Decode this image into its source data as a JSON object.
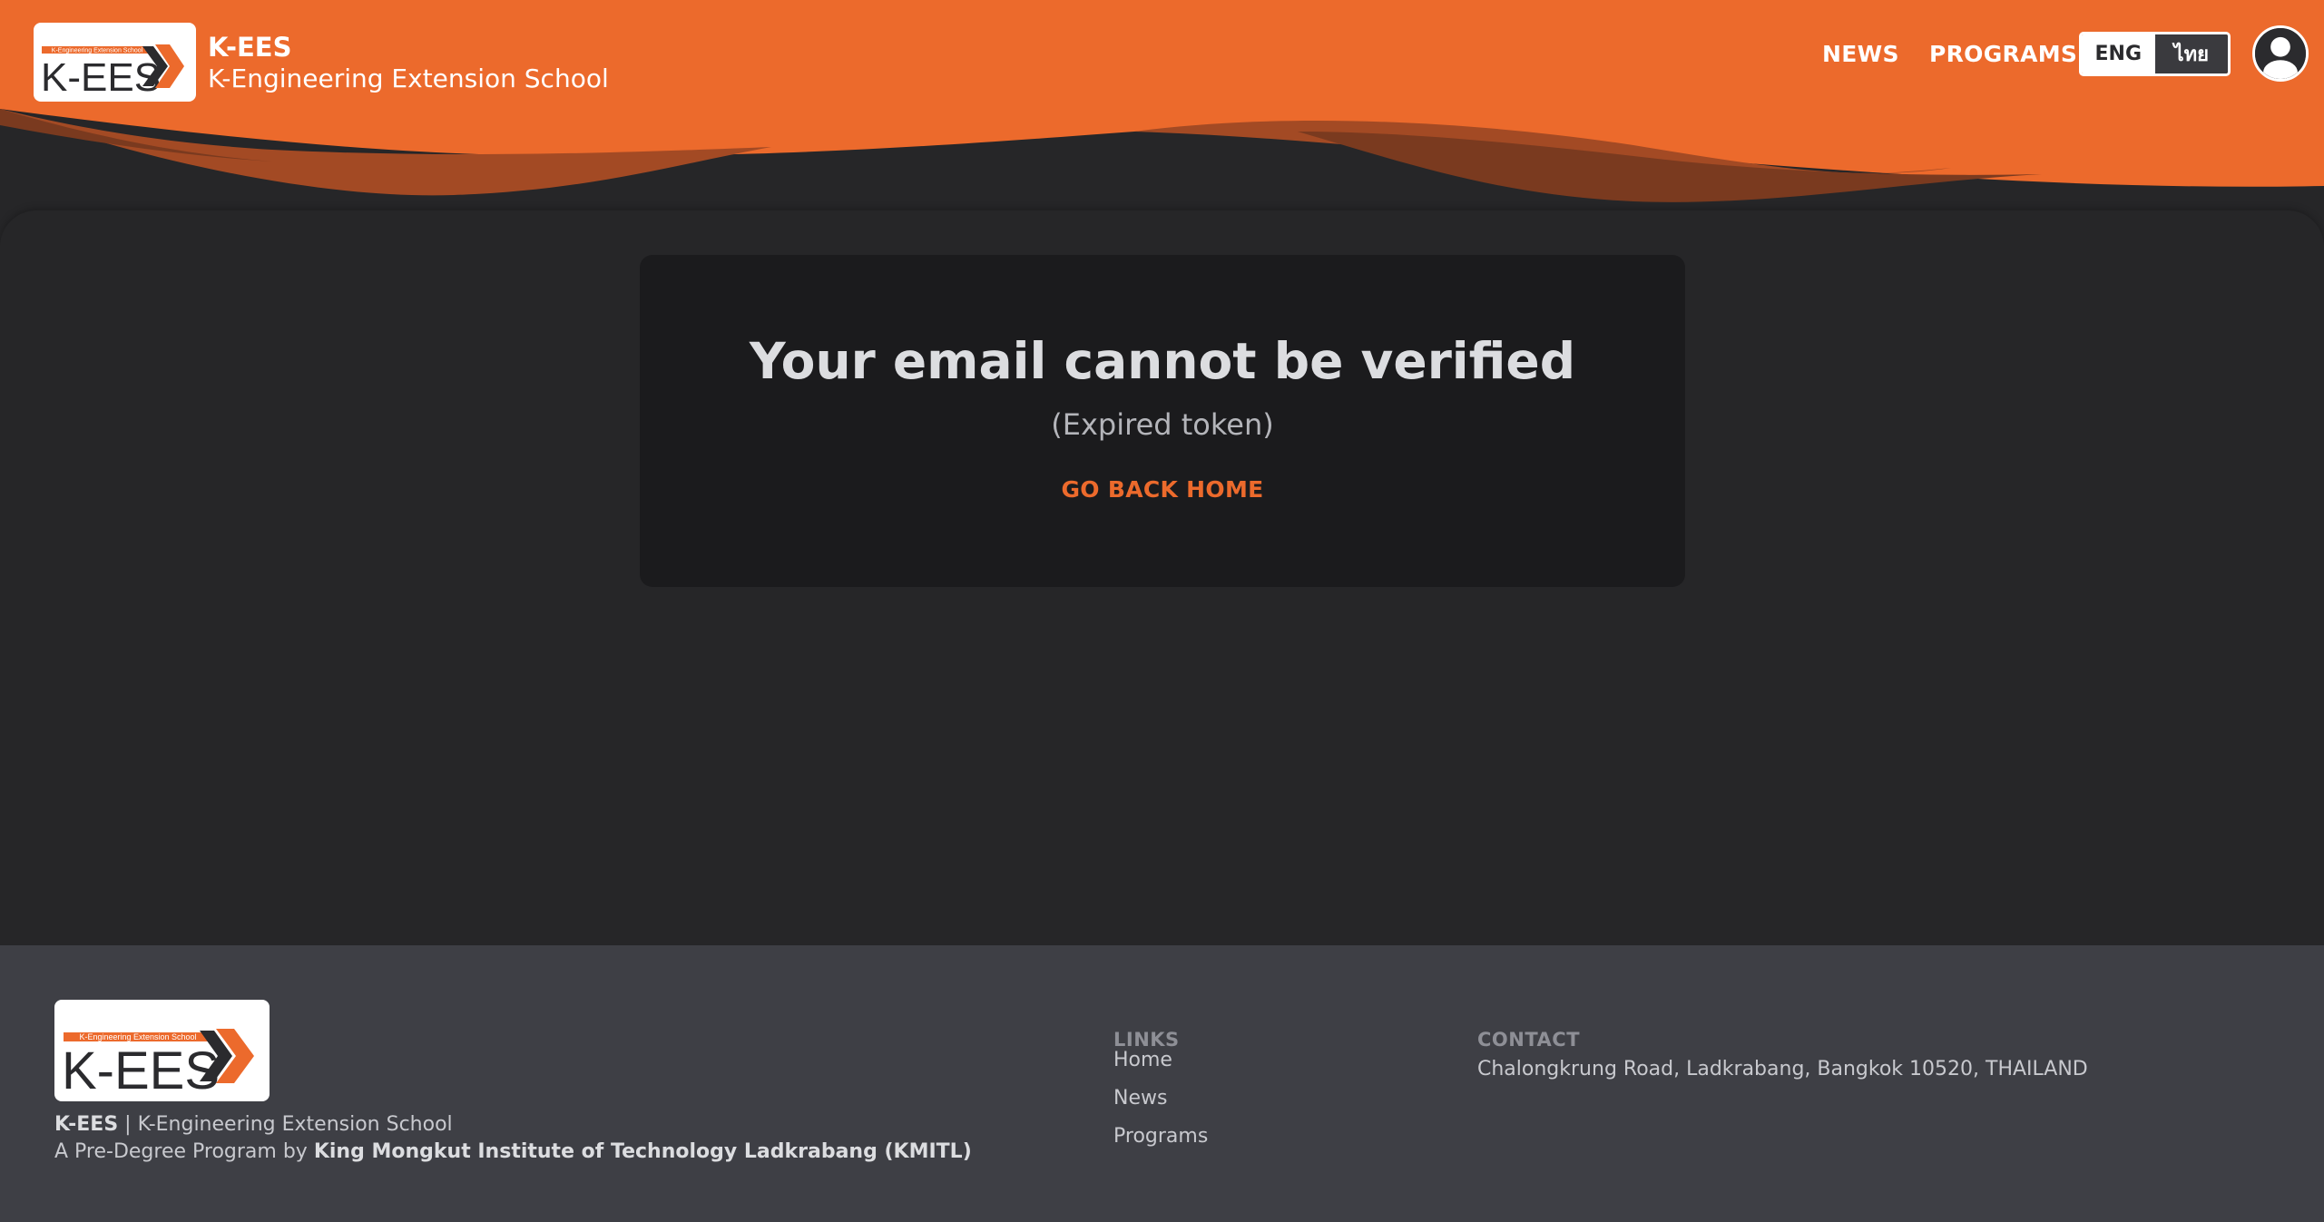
{
  "header": {
    "logo_text": "K-EES",
    "logo_banner": "K-Engineering Extension School",
    "brand_name": "K-EES",
    "brand_subtitle": "K-Engineering Extension School",
    "nav": [
      {
        "label": "NEWS"
      },
      {
        "label": "PROGRAMS"
      }
    ],
    "lang": {
      "eng": "ENG",
      "thai": "ไทย",
      "selected": "ENG"
    },
    "avatar_icon": "user-avatar-icon"
  },
  "main": {
    "title": "Your email cannot be verified",
    "subtitle": "(Expired token)",
    "link_label": "GO BACK HOME"
  },
  "footer": {
    "logo_text": "K-EES",
    "logo_banner": "K-Engineering Extension School",
    "brand_short": "K-EES",
    "brand_sep": " | ",
    "brand_long": "K-Engineering Extension School",
    "program_prefix": "A Pre-Degree Program by ",
    "program_org": "King Mongkut Institute of Technology Ladkrabang (KMITL)",
    "links_title": "LINKS",
    "links": [
      {
        "label": "Home"
      },
      {
        "label": "News"
      },
      {
        "label": "Programs"
      }
    ],
    "contact_title": "CONTACT",
    "contact_address": "Chalongkrung Road, Ladkrabang, Bangkok 10520, THAILAND"
  },
  "colors": {
    "accent": "#ec6a2c",
    "dark_bg": "#262628",
    "card_bg": "#1b1b1d",
    "footer_bg": "#3e3f45"
  }
}
